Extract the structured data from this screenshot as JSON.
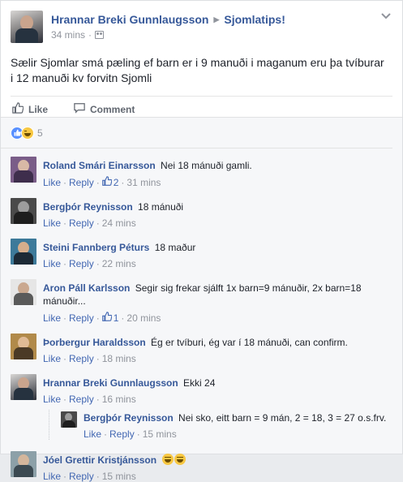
{
  "post": {
    "author": "Hrannar Breki Gunnlaugsson",
    "group": "Sjomlatips!",
    "time": "34 mins",
    "text": "Sælir Sjomlar smá pæling ef barn er i 9 manuði i maganum eru þa tvíburar i 12 manuði kv forvitn Sjomli",
    "like_label": "Like",
    "comment_label": "Comment",
    "reaction_count": "5"
  },
  "comment_actions": {
    "like": "Like",
    "reply": "Reply"
  },
  "comments": [
    {
      "author": "Roland Smári Einarsson",
      "text": "Nei 18 mánuði gamli.",
      "likes": "2",
      "time": "31 mins"
    },
    {
      "author": "Bergþór Reynisson",
      "text": "18 mánuði",
      "likes": "",
      "time": "24 mins"
    },
    {
      "author": "Steini Fannberg Péturs",
      "text": "18 maður",
      "likes": "",
      "time": "22 mins"
    },
    {
      "author": "Aron Páll Karlsson",
      "text": "Segir sig frekar sjálft 1x barn=9 mánuðir, 2x barn=18 mánuðir...",
      "likes": "1",
      "time": "20 mins"
    },
    {
      "author": "Þorbergur Haraldsson",
      "text": "Ég er tvíburi, ég var í 18 mánuði, can confirm.",
      "likes": "",
      "time": "18 mins"
    },
    {
      "author": "Hrannar Breki Gunnlaugsson",
      "text": "Ekki 24",
      "likes": "",
      "time": "16 mins"
    },
    {
      "author": "Bergþór Reynisson",
      "text": "Nei sko, eitt barn = 9 mán, 2 = 18, 3 = 27 o.s.frv.",
      "likes": "",
      "time": "15 mins"
    },
    {
      "author": "Jóel Grettir Kristjánsson",
      "text": "",
      "likes": "",
      "time": "15 mins"
    }
  ],
  "colors": {
    "link": "#365899",
    "action": "#4267b2",
    "muted": "#90949c",
    "like_blue": "#5890ff"
  }
}
